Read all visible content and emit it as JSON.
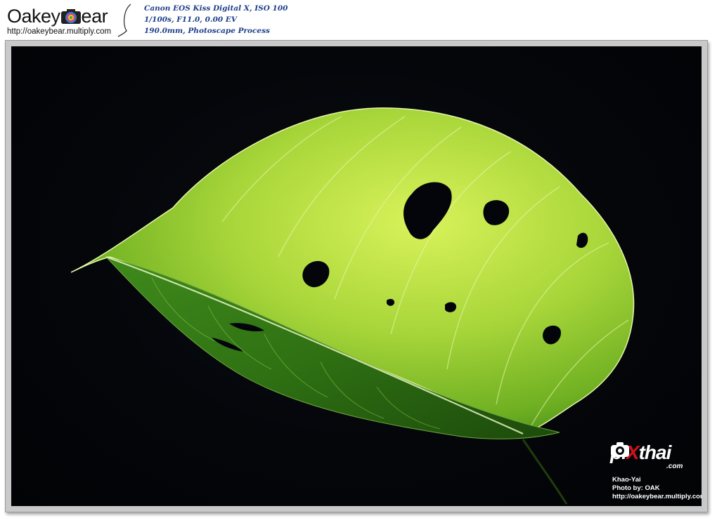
{
  "header": {
    "logo": {
      "text_before": "Oake",
      "text_highlight": "y",
      "text_after": "ear",
      "icon": "camera-lens-icon",
      "url": "http://oakeybear.multiply.com"
    },
    "exif": {
      "line1": "Canon EOS Kiss Digital X, ISO 100",
      "line2": "1/100s, F11.0, 0.00 EV",
      "line3": "190.0mm, Photoscape Process"
    }
  },
  "photo": {
    "subject": "backlit-green-leaf",
    "colors": {
      "background": "#05070b",
      "leaf_light": "#c8e84a",
      "leaf_mid": "#7fbf2a",
      "leaf_dark": "#2e6b12",
      "frame": "#c9c9c9"
    }
  },
  "watermark": {
    "brand_part1": "pi",
    "brand_x": "X",
    "brand_part2": "thai",
    "brand_suffix": ".com",
    "camera_icon": "camera-icon",
    "location": "Khao-Yai",
    "credit": "Photo by: OAK",
    "url": "http://oakeybear.multiply.com"
  }
}
